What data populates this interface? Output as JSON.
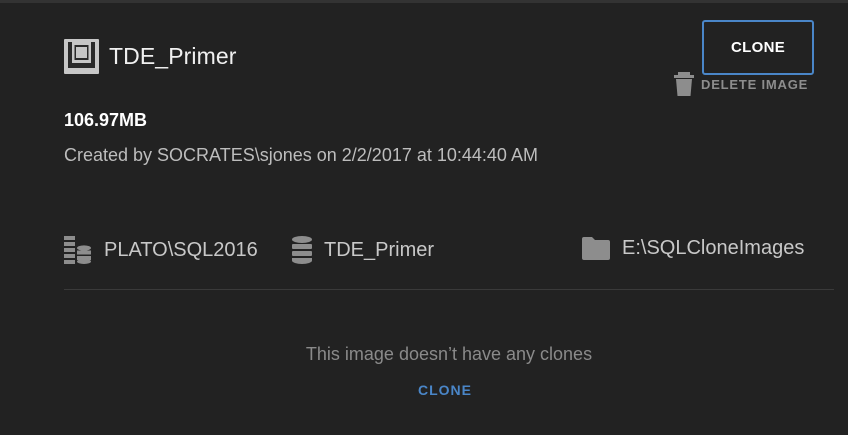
{
  "image": {
    "name": "TDE_Primer",
    "size": "106.97MB",
    "created": "Created by SOCRATES\\sjones on 2/2/2017 at 10:44:40 AM"
  },
  "actions": {
    "clone_label": "CLONE",
    "delete_label": "DELETE IMAGE"
  },
  "details": {
    "server": "PLATO\\SQL2016",
    "database": "TDE_Primer",
    "location": "E:\\SQLCloneImages"
  },
  "clones": {
    "empty_message": "This image doesn’t have any clones",
    "clone_link": "CLONE"
  },
  "icons": {
    "image": "disk-image-icon",
    "delete": "trash-icon",
    "server": "server-icon",
    "database": "database-icon",
    "location": "folder-icon"
  },
  "colors": {
    "background": "#222222",
    "accent": "#4a86c8",
    "muted": "#8a8a8a"
  }
}
